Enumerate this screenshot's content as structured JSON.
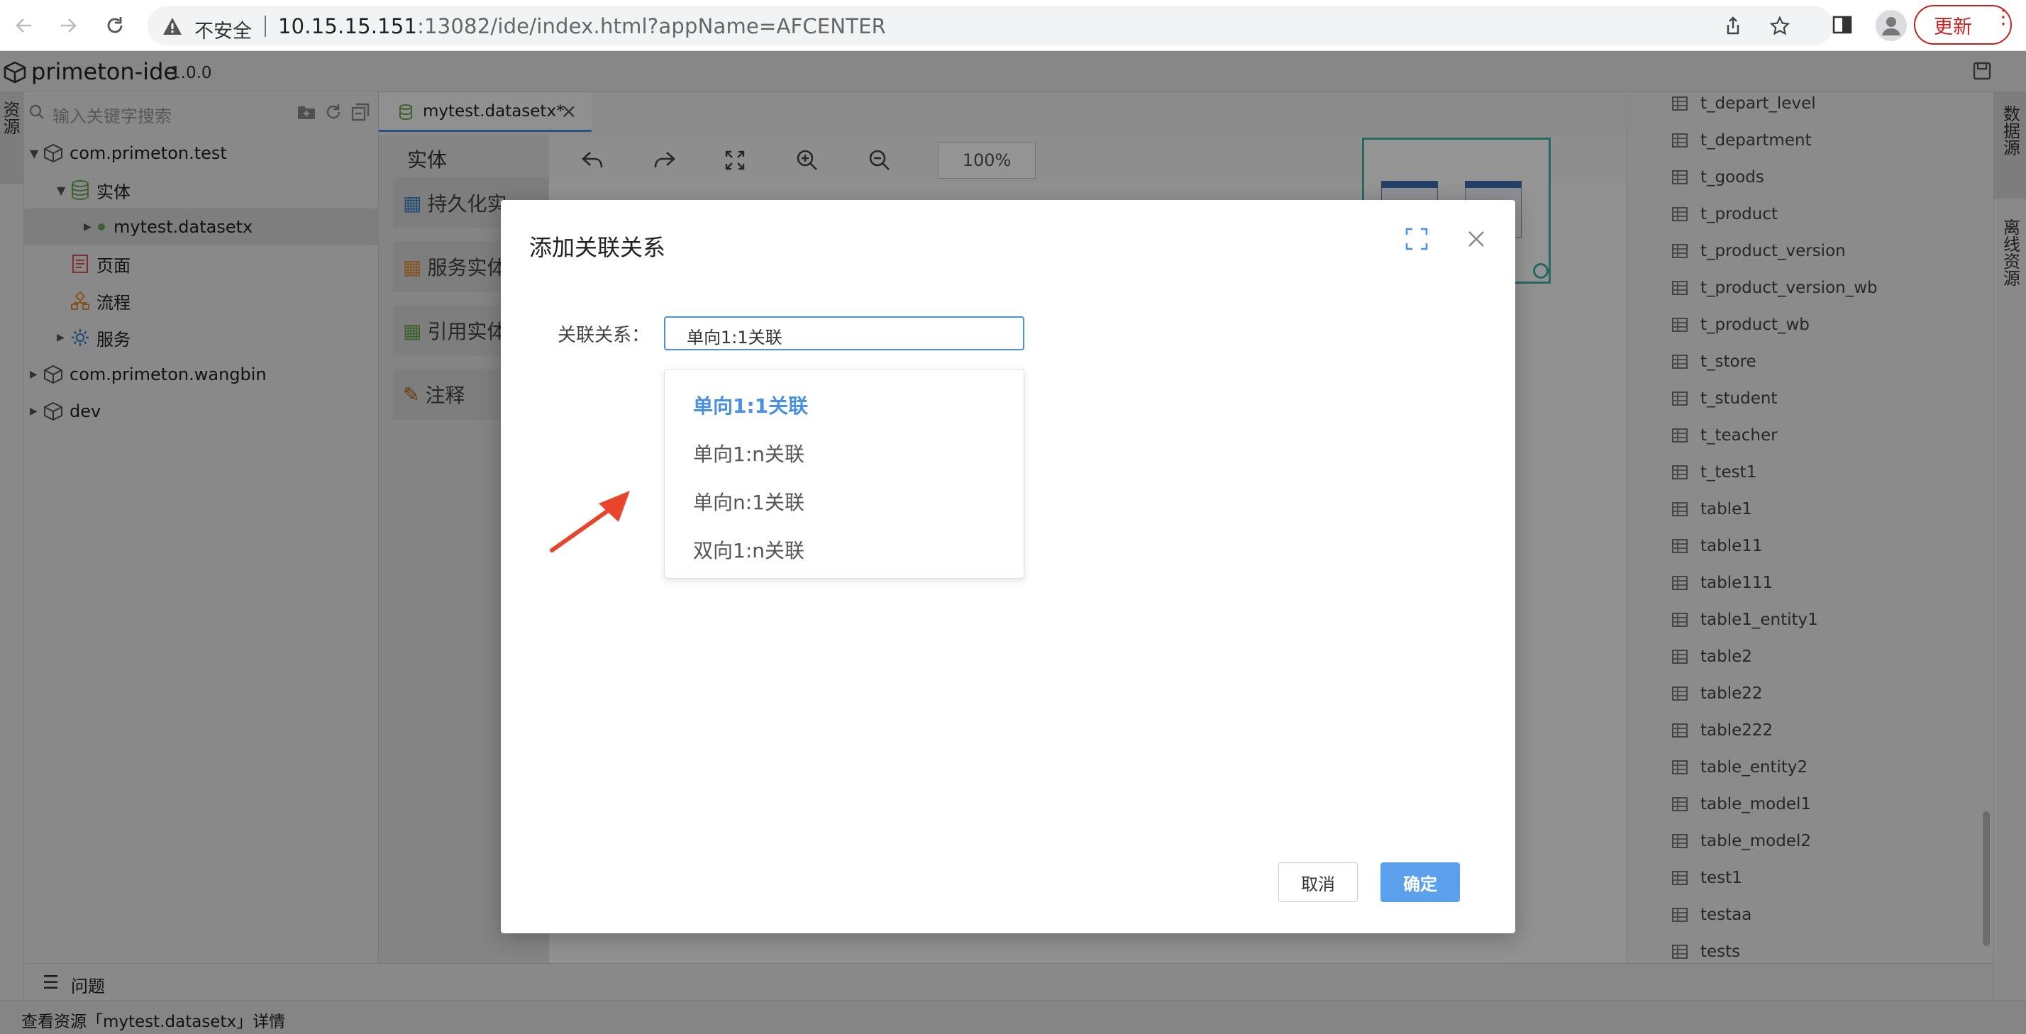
{
  "browser": {
    "security_label": "不安全",
    "url_host": "10.15.15.151",
    "url_rest": ":13082/ide/index.html?appName=AFCENTER",
    "update_label": "更新"
  },
  "ide": {
    "title": "primeton-ide",
    "version": "1.0.0"
  },
  "left_strip": {
    "tab_label": "资源"
  },
  "tree": {
    "search_placeholder": "输入关键字搜索",
    "items": [
      {
        "label": "com.primeton.test"
      },
      {
        "label": "实体"
      },
      {
        "label": "mytest.datasetx"
      },
      {
        "label": "页面"
      },
      {
        "label": "流程"
      },
      {
        "label": "服务"
      },
      {
        "label": "com.primeton.wangbin"
      },
      {
        "label": "dev"
      }
    ]
  },
  "editor": {
    "tab_label": "mytest.datasetx*",
    "palette_header": "实体",
    "palette_items": [
      "持久化实",
      "服务实体",
      "引用实体",
      "注释"
    ],
    "zoom": "100%"
  },
  "db_tables": [
    "t_depart_level",
    "t_department",
    "t_goods",
    "t_product",
    "t_product_version",
    "t_product_version_wb",
    "t_product_wb",
    "t_store",
    "t_student",
    "t_teacher",
    "t_test1",
    "table1",
    "table11",
    "table111",
    "table1_entity1",
    "table2",
    "table22",
    "table222",
    "table_entity2",
    "table_model1",
    "table_model2",
    "test1",
    "testaa",
    "tests"
  ],
  "right_strip": {
    "tab1": "数据源",
    "tab2": "离线资源"
  },
  "problems_label": "问题",
  "status_text": "查看资源「mytest.datasetx」详情",
  "modal": {
    "title": "添加关联关系",
    "field_label": "关联关系：",
    "selected_value": "单向1:1关联",
    "options": [
      "单向1:1关联",
      "单向1:n关联",
      "单向n:1关联",
      "双向1:n关联"
    ],
    "cancel_label": "取消",
    "ok_label": "确定"
  },
  "colors": {
    "accent": "#4a90e2",
    "confirm": "#5aa0ec",
    "annotation_arrow": "#e8452c",
    "update": "#c5221f"
  }
}
